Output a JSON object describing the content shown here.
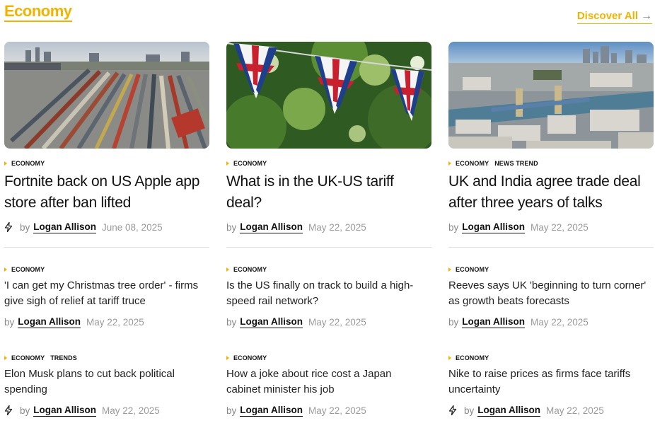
{
  "section": {
    "title": "Economy",
    "discover_label": "Discover All"
  },
  "colors": {
    "accent": "#f2b300",
    "text": "#111111",
    "muted": "#9a9a9a"
  },
  "icons": {
    "discover_arrow": "arrow-right-icon",
    "trending": "lightning-bolt-icon"
  },
  "featured": [
    {
      "tags": [
        "ECONOMY"
      ],
      "title": "Fortnite back on US Apple app store after ban lifted",
      "by": "by",
      "author": "Logan Allison",
      "date": "June 08, 2025",
      "image": "rail-yard-photo",
      "trending": true
    },
    {
      "tags": [
        "ECONOMY"
      ],
      "title": "What is in the UK-US tariff deal?",
      "by": "by",
      "author": "Logan Allison",
      "date": "May 22, 2025",
      "image": "union-jack-bunting-photo",
      "trending": false
    },
    {
      "tags": [
        "ECONOMY",
        "NEWS TREND"
      ],
      "title": "UK and India agree trade deal after three years of talks",
      "by": "by",
      "author": "Logan Allison",
      "date": "May 22, 2025",
      "image": "london-tower-bridge-photo",
      "trending": false
    }
  ],
  "list_row1": [
    {
      "tags": [
        "ECONOMY"
      ],
      "title": "'I can get my Christmas tree order' - firms give sigh of relief at tariff truce",
      "by": "by",
      "author": "Logan Allison",
      "date": "May 22, 2025",
      "trending": false
    },
    {
      "tags": [
        "ECONOMY"
      ],
      "title": "Is the US finally on track to build a high-speed rail network?",
      "by": "by",
      "author": "Logan Allison",
      "date": "May 22, 2025",
      "trending": false
    },
    {
      "tags": [
        "ECONOMY"
      ],
      "title": "Reeves says UK 'beginning to turn corner' as growth beats forecasts",
      "by": "by",
      "author": "Logan Allison",
      "date": "May 22, 2025",
      "trending": false
    }
  ],
  "list_row2": [
    {
      "tags": [
        "ECONOMY",
        "TRENDS"
      ],
      "title": "Elon Musk plans to cut back political spending",
      "by": "by",
      "author": "Logan Allison",
      "date": "May 22, 2025",
      "trending": true
    },
    {
      "tags": [
        "ECONOMY"
      ],
      "title": "How a joke about rice cost a Japan cabinet minister his job",
      "by": "by",
      "author": "Logan Allison",
      "date": "May 22, 2025",
      "trending": false
    },
    {
      "tags": [
        "ECONOMY"
      ],
      "title": "Nike to raise prices as firms face tariffs uncertainty",
      "by": "by",
      "author": "Logan Allison",
      "date": "May 22, 2025",
      "trending": true
    }
  ]
}
